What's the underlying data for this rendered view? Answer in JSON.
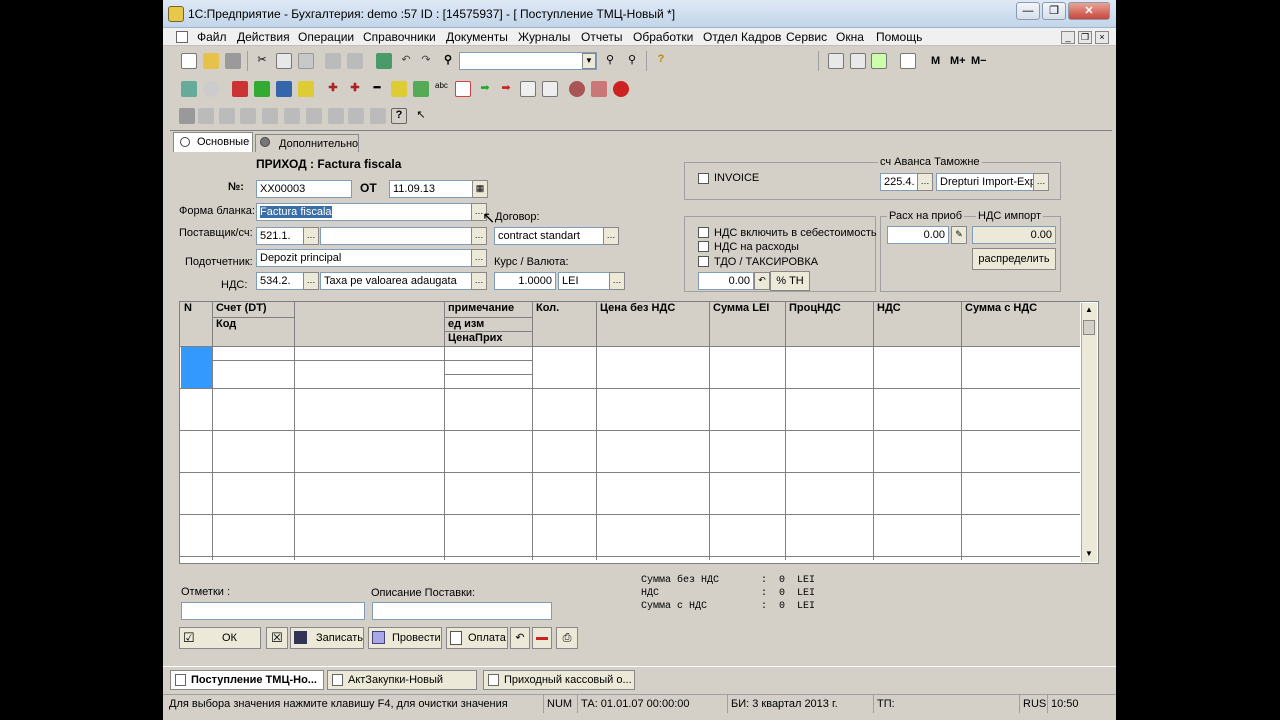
{
  "window": {
    "title": "1С:Предприятие - Бухгалтерия: demo :57 ID : [14575937] - [ Поступление ТМЦ-Новый *]"
  },
  "menu": [
    "Файл",
    "Действия",
    "Операции",
    "Справочники",
    "Документы",
    "Журналы",
    "Отчеты",
    "Обработки",
    "Отдел Кадров",
    "Сервис",
    "Окна",
    "Помощь"
  ],
  "toolbar": {
    "m": "M",
    "mplus": "M+",
    "mminus": "M−"
  },
  "tabs": {
    "main": "Основные",
    "extra": "Дополнительно"
  },
  "header": {
    "title": "ПРИХОД : Factura fiscala",
    "num_label": "№:",
    "num_value": "ХХ00003",
    "from_label": "ОТ",
    "date_value": "11.09.13",
    "form_label": "Форма бланка:",
    "form_value": "Factura fiscala",
    "supplier_label": "Поставщик/сч:",
    "supplier_account": "521.1.",
    "contract_label": "Договор:",
    "contract_value": "contract standart",
    "accountable_label": "Подотчетник:",
    "accountable_value": "Depozit principal",
    "rate_label": "Курс / Валюта:",
    "vat_label": "НДС:",
    "vat_account": "534.2.",
    "vat_value": "Taxa pe valoarea adaugata",
    "rate_value": "1.0000",
    "currency_value": "LEI"
  },
  "right": {
    "invoice_label": "INVOICE",
    "advance_label": "сч Аванса  Таможне",
    "advance_account": "225.4.",
    "customs_value": "Drepturi Import-Expor",
    "vat_in_cost": "НДС включить в себестоимость",
    "vat_expense": "НДС на расходы",
    "tdo": "ТДО / ТАКСИРОВКА",
    "tdo_value": "0.00",
    "percent_label": "% ТН",
    "expense_label": "Расх на приоб",
    "vat_import_label": "НДС импорт",
    "expense_value": "0.00",
    "vat_import_value": "0.00",
    "distribute_label": "распределить"
  },
  "grid": {
    "headers": {
      "n": "N",
      "account": "Счет (DT)",
      "code": "Код",
      "note": "примечание",
      "unit": "ед изм",
      "price_in": "ЦенаПрих",
      "qty": "Кол.",
      "price_novat": "Цена без НДС",
      "sum_lei": "Сумма LEI",
      "vat_pct": "ПроцНДС",
      "vat": "НДС",
      "sum_vat": "Сумма с НДС"
    }
  },
  "footer": {
    "notes_label": "Отметки :",
    "delivery_label": "Описание Поставки:",
    "sum_novat": "Сумма без НДС       :  0  LEI",
    "vat_total": "НДС                 :  0  LEI",
    "sum_withvat": "Сумма с НДС         :  0  LEI",
    "ok": "ОК",
    "save": "Записать",
    "post": "Провести",
    "pay": "Оплата"
  },
  "taskbar": [
    "Поступление ТМЦ-Но...",
    "АктЗакупки-Новый",
    "Приходный кассовый о..."
  ],
  "status": {
    "hint": "Для выбора значения нажмите клавишу F4, для очистки значения",
    "num": "NUM",
    "ta": "ТА: 01.01.07  00:00:00",
    "bi": "БИ: 3 квартал 2013 г.",
    "tp": "ТП:",
    "lang": "RUS",
    "time": "10:50"
  }
}
